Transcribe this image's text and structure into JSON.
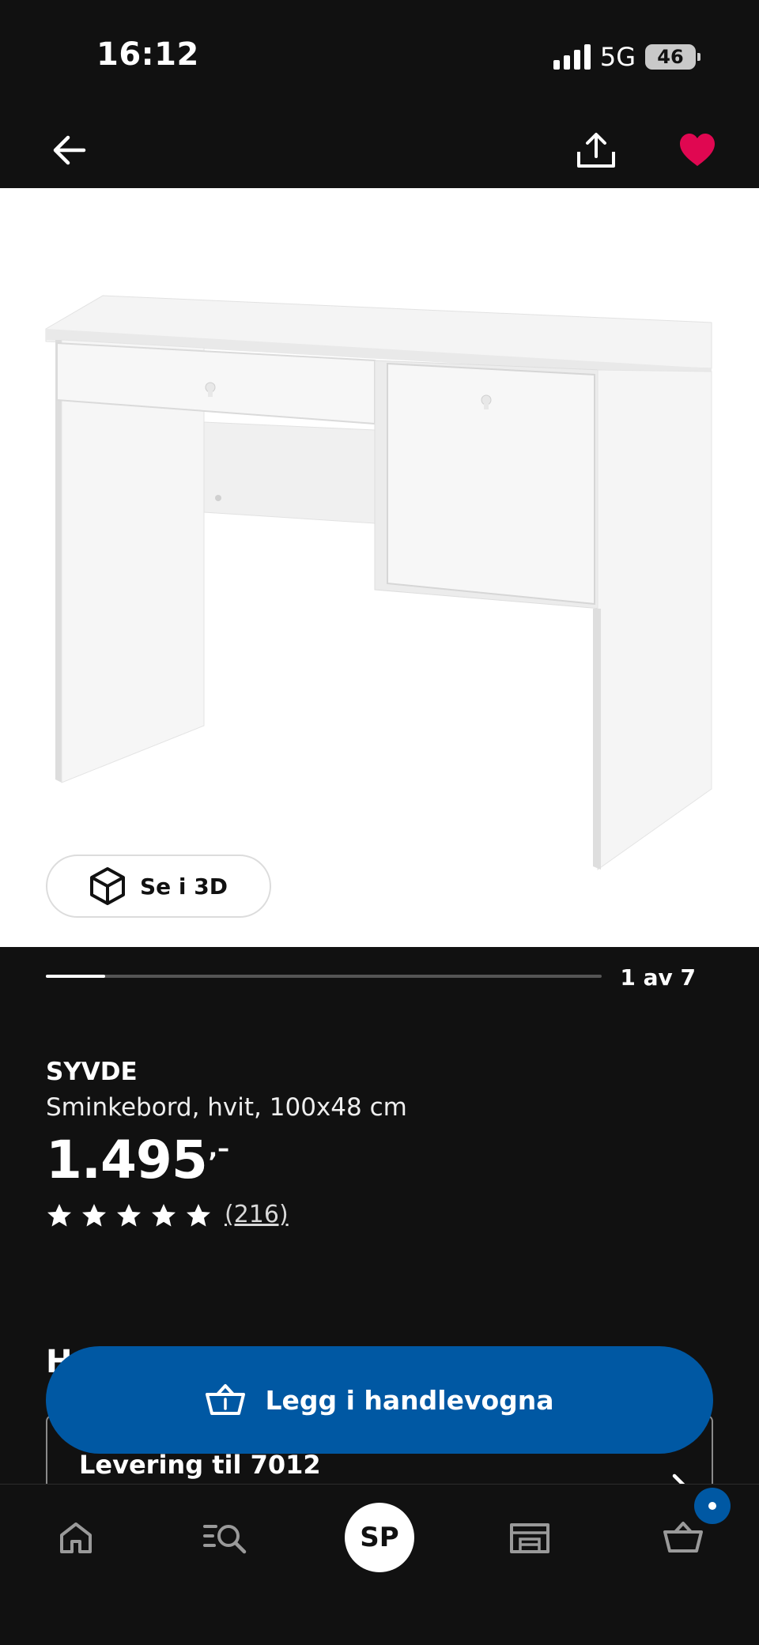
{
  "status_bar": {
    "time": "16:12",
    "network": "5G",
    "battery": "46"
  },
  "top_nav": {
    "back_icon": "arrow-left-icon",
    "share_icon": "share-icon",
    "favorite_icon": "heart-icon",
    "favorite_color": "#e00751"
  },
  "product_image": {
    "view_3d_label": "Se i 3D",
    "view_3d_icon": "cube-icon"
  },
  "carousel": {
    "counter": "1 av 7",
    "progress": 0.107
  },
  "product": {
    "name": "SYVDE",
    "description": "Sminkebord, hvit, 100x48 cm",
    "price_integer": "1.495",
    "price_decimal": ",–",
    "rating": 5,
    "review_count": "(216)"
  },
  "section": {
    "heading_peek": "H",
    "delivery_title": "Levering til 7012"
  },
  "cart_button": {
    "label": "Legg i handlevogna",
    "icon": "basket-icon",
    "color": "#0058a3"
  },
  "bottom_nav": {
    "home_icon": "home-icon",
    "search_icon": "search-list-icon",
    "profile_initials": "SP",
    "stores_icon": "store-icon",
    "cart_icon": "basket-icon"
  }
}
